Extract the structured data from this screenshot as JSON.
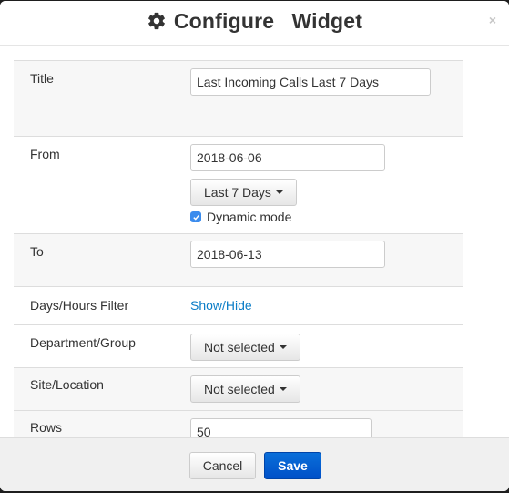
{
  "dialog": {
    "title": "Configure  Widget",
    "icon": "gear-icon",
    "close_label": "×"
  },
  "form": {
    "title": {
      "label": "Title",
      "value": "Last Incoming Calls Last 7 Days"
    },
    "from": {
      "label": "From",
      "value": "2018-06-06",
      "range_preset": "Last 7 Days",
      "dynamic_mode_label": "Dynamic mode",
      "dynamic_mode_checked": true
    },
    "to": {
      "label": "To",
      "value": "2018-06-13"
    },
    "days_hours_filter": {
      "label": "Days/Hours Filter",
      "link_text": "Show/Hide"
    },
    "department_group": {
      "label": "Department/Group",
      "selected": "Not selected"
    },
    "site_location": {
      "label": "Site/Location",
      "selected": "Not selected"
    },
    "rows": {
      "label": "Rows",
      "value": "50"
    }
  },
  "footer": {
    "cancel_label": "Cancel",
    "save_label": "Save"
  },
  "colors": {
    "primary": "#0a6fd9",
    "link": "#0b7dc7",
    "checkbox": "#3b8ced",
    "row_shade": "#f7f7f7",
    "footer_bg": "#f0f0f0"
  }
}
